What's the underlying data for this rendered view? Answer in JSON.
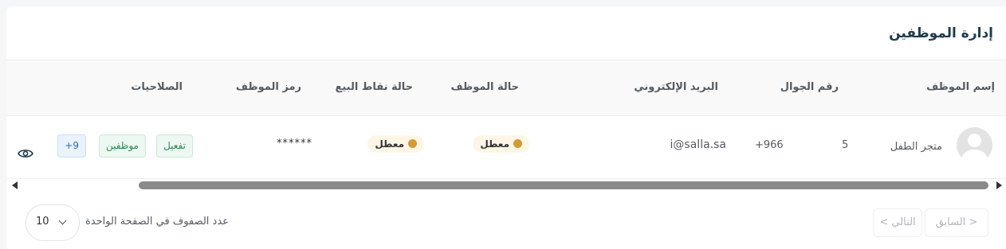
{
  "page": {
    "title": "إدارة الموظفين"
  },
  "table": {
    "headers": {
      "name": "إسم الموظف",
      "mobile": "رقم الجوال",
      "email": "البريد الإلكتروني",
      "employee_status": "حالة الموظف",
      "pos_status": "حالة نقاط البيع",
      "employee_code": "رمز الموظف",
      "permissions": "الصلاحيات"
    },
    "rows": [
      {
        "name": "متجر الطفل",
        "mobile_code": "+966",
        "mobile_number": "5",
        "email": "i@salla.sa",
        "employee_status": "معطل",
        "pos_status": "معطل",
        "employee_code": "******",
        "permissions": [
          "تفعيل",
          "موظفين"
        ],
        "more_permissions": "+9"
      }
    ]
  },
  "pagination": {
    "prev_label": "< السابق",
    "next_label": "التالي >",
    "rows_per_page_label": "عدد الصفوف في الصفحة الواحدة",
    "rows_per_page_value": "10"
  },
  "colors": {
    "status_dot": "#d49a36",
    "title": "#1f3b4d"
  },
  "icons": {
    "view": "eye-icon",
    "avatar": "user-avatar-placeholder",
    "select": "chevron-down-icon"
  }
}
